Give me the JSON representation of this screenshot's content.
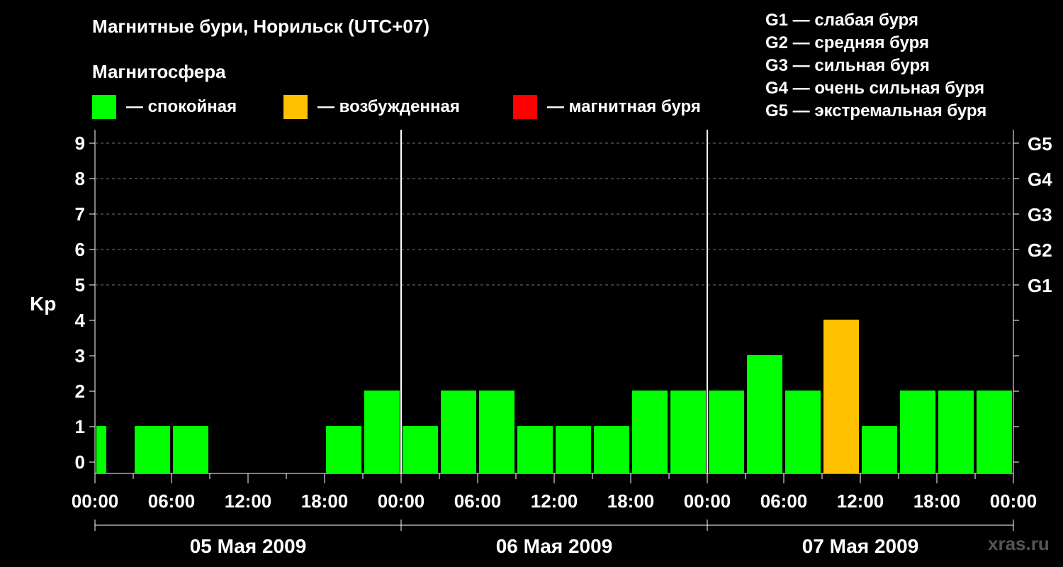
{
  "header": {
    "title": "Магнитные бури, Норильск (UTC+07)",
    "subtitle": "Магнитосфера"
  },
  "state_legend": [
    {
      "label": "— спокойная",
      "color": "#00ff00"
    },
    {
      "label": "— возбужденная",
      "color": "#ffc000"
    },
    {
      "label": "— магнитная буря",
      "color": "#ff0000"
    }
  ],
  "g_legend": [
    "G1 — слабая буря",
    "G2 — средняя буря",
    "G3 — сильная буря",
    "G4 — очень сильная буря",
    "G5 — экстремальная буря"
  ],
  "watermark": "xras.ru",
  "chart_data": {
    "type": "bar",
    "ylabel": "Kp",
    "ylim": [
      0,
      9
    ],
    "yticks": [
      0,
      1,
      2,
      3,
      4,
      5,
      6,
      7,
      8,
      9
    ],
    "g_scale": [
      {
        "kp": 5,
        "label": "G1"
      },
      {
        "kp": 6,
        "label": "G2"
      },
      {
        "kp": 7,
        "label": "G3"
      },
      {
        "kp": 8,
        "label": "G4"
      },
      {
        "kp": 9,
        "label": "G5"
      }
    ],
    "x_hours_range": [
      0,
      72
    ],
    "xtick_labels": [
      "00:00",
      "06:00",
      "12:00",
      "18:00",
      "00:00",
      "06:00",
      "12:00",
      "18:00",
      "00:00",
      "06:00",
      "12:00",
      "18:00",
      "00:00"
    ],
    "day_labels": [
      "05 Мая 2009",
      "06 Мая 2009",
      "07 Мая 2009"
    ],
    "colors": {
      "quiet": "#00ff00",
      "active": "#ffc000",
      "storm": "#ff0000"
    },
    "bars": [
      {
        "date": "05 Мая 2009",
        "time": "00:00",
        "kp": 1,
        "state": "quiet"
      },
      {
        "date": "05 Мая 2009",
        "time": "03:00",
        "kp": 1,
        "state": "quiet"
      },
      {
        "date": "05 Мая 2009",
        "time": "06:00",
        "kp": 1,
        "state": "quiet"
      },
      {
        "date": "05 Мая 2009",
        "time": "09:00",
        "kp": 0,
        "state": "quiet"
      },
      {
        "date": "05 Мая 2009",
        "time": "12:00",
        "kp": 0,
        "state": "quiet"
      },
      {
        "date": "05 Мая 2009",
        "time": "15:00",
        "kp": 0,
        "state": "quiet"
      },
      {
        "date": "05 Мая 2009",
        "time": "18:00",
        "kp": 1,
        "state": "quiet"
      },
      {
        "date": "05 Мая 2009",
        "time": "21:00",
        "kp": 2,
        "state": "quiet"
      },
      {
        "date": "06 Мая 2009",
        "time": "00:00",
        "kp": 1,
        "state": "quiet"
      },
      {
        "date": "06 Мая 2009",
        "time": "03:00",
        "kp": 2,
        "state": "quiet"
      },
      {
        "date": "06 Мая 2009",
        "time": "06:00",
        "kp": 2,
        "state": "quiet"
      },
      {
        "date": "06 Мая 2009",
        "time": "09:00",
        "kp": 1,
        "state": "quiet"
      },
      {
        "date": "06 Мая 2009",
        "time": "12:00",
        "kp": 1,
        "state": "quiet"
      },
      {
        "date": "06 Мая 2009",
        "time": "15:00",
        "kp": 1,
        "state": "quiet"
      },
      {
        "date": "06 Мая 2009",
        "time": "18:00",
        "kp": 2,
        "state": "quiet"
      },
      {
        "date": "06 Мая 2009",
        "time": "21:00",
        "kp": 2,
        "state": "quiet"
      },
      {
        "date": "07 Мая 2009",
        "time": "00:00",
        "kp": 2,
        "state": "quiet"
      },
      {
        "date": "07 Мая 2009",
        "time": "03:00",
        "kp": 3,
        "state": "quiet"
      },
      {
        "date": "07 Мая 2009",
        "time": "06:00",
        "kp": 2,
        "state": "quiet"
      },
      {
        "date": "07 Мая 2009",
        "time": "09:00",
        "kp": 4,
        "state": "active"
      },
      {
        "date": "07 Мая 2009",
        "time": "12:00",
        "kp": 1,
        "state": "quiet"
      },
      {
        "date": "07 Мая 2009",
        "time": "15:00",
        "kp": 2,
        "state": "quiet"
      },
      {
        "date": "07 Мая 2009",
        "time": "18:00",
        "kp": 2,
        "state": "quiet"
      },
      {
        "date": "07 Мая 2009",
        "time": "21:00",
        "kp": 2,
        "state": "quiet"
      }
    ]
  }
}
